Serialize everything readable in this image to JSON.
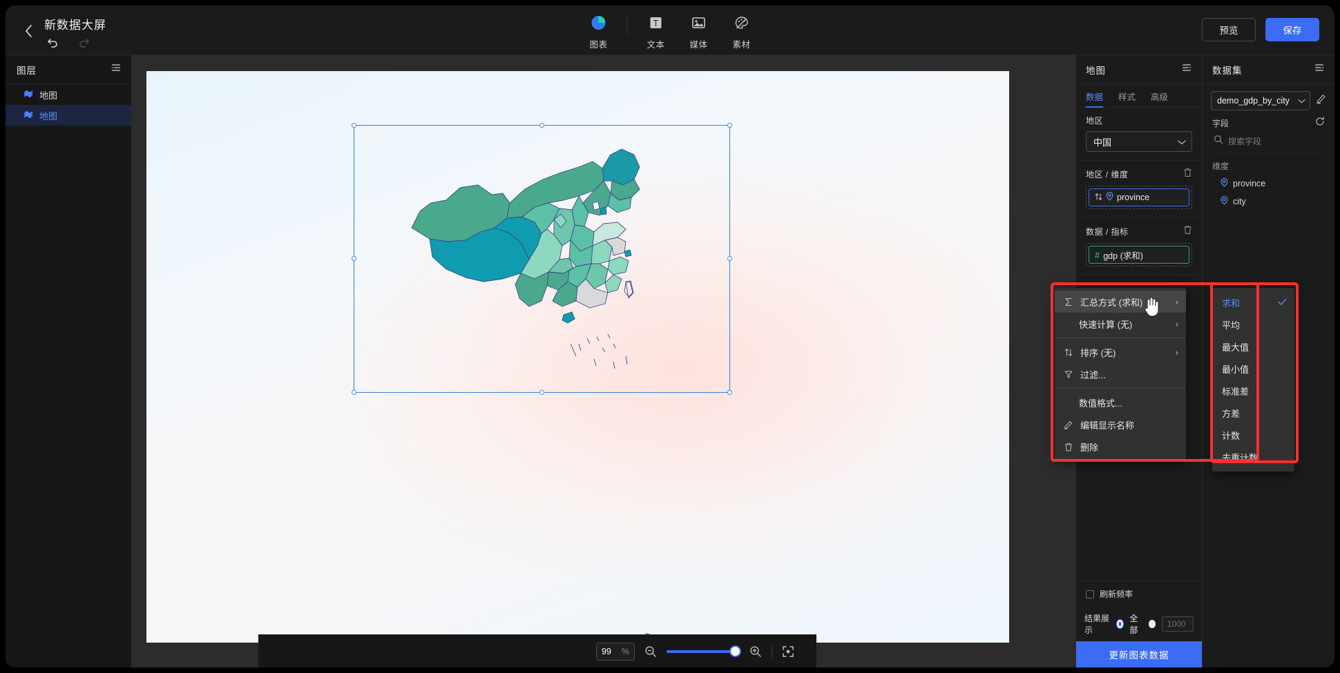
{
  "topbar": {
    "back_icon": "chevron-left-icon",
    "title": "新数据大屏",
    "undo_icon": "undo-icon",
    "redo_icon": "redo-icon",
    "tools": [
      {
        "label": "图表",
        "icon": "pie-chart-icon"
      },
      {
        "label": "文本",
        "icon": "text-t-icon"
      },
      {
        "label": "媒体",
        "icon": "image-icon"
      },
      {
        "label": "素材",
        "icon": "palette-icon"
      }
    ],
    "preview_label": "预览",
    "save_label": "保存"
  },
  "layers": {
    "title": "图层",
    "collapse_icon": "collapse-panel-icon",
    "items": [
      {
        "label": "地图",
        "icon": "map-layer-icon",
        "selected": false
      },
      {
        "label": "地图",
        "icon": "map-layer-icon",
        "selected": true
      }
    ]
  },
  "canvas": {
    "chart_one_title": "地图",
    "chart_two_title": "地图"
  },
  "config": {
    "title": "地图",
    "collapse_icon": "collapse-panel-icon",
    "tabs": [
      {
        "label": "数据",
        "active": true
      },
      {
        "label": "样式",
        "active": false
      },
      {
        "label": "高级",
        "active": false
      }
    ],
    "region_label": "地区",
    "region_value": "中国",
    "dimension_label": "地区 / 维度",
    "dimension_chip": "province",
    "dimension_icons": [
      "sort-icon",
      "location-pin-icon"
    ],
    "metric_label": "数据 / 指标",
    "metric_chip": "gdp (求和)",
    "metric_icon": "hash-icon",
    "delete_icon": "trash-icon",
    "refresh_rate_label": "刷新频率",
    "result_label": "结果展示",
    "result_all_label": "全部",
    "result_limit_placeholder": "1000",
    "update_button": "更新图表数据"
  },
  "context_menu": {
    "items": [
      {
        "label": "汇总方式 (求和)",
        "icon": "sigma-icon",
        "arrow": "›",
        "hover": true
      },
      {
        "label": "快速计算 (无)",
        "icon": "",
        "arrow": "›",
        "hover": false
      },
      {
        "label": "排序 (无)",
        "icon": "sort-icon",
        "arrow": "›",
        "hover": false
      },
      {
        "label": "过滤...",
        "icon": "filter-icon",
        "arrow": "",
        "hover": false
      },
      {
        "label": "数值格式...",
        "icon": "",
        "arrow": "",
        "hover": false
      },
      {
        "label": "编辑显示名称",
        "icon": "pencil-icon",
        "arrow": "",
        "hover": false
      },
      {
        "label": "删除",
        "icon": "trash-icon",
        "arrow": "",
        "hover": false
      }
    ]
  },
  "submenu": {
    "items": [
      {
        "label": "求和",
        "selected": true
      },
      {
        "label": "平均",
        "selected": false
      },
      {
        "label": "最大值",
        "selected": false
      },
      {
        "label": "最小值",
        "selected": false
      },
      {
        "label": "标准差",
        "selected": false
      },
      {
        "label": "方差",
        "selected": false
      },
      {
        "label": "计数",
        "selected": false
      },
      {
        "label": "去重计数",
        "selected": false
      }
    ],
    "check_icon": "check-icon"
  },
  "dataset": {
    "title": "数据集",
    "collapse_icon": "collapse-panel-icon",
    "name": "demo_gdp_by_city",
    "edit_icon": "pencil-icon",
    "fields_label": "字段",
    "refresh_icon": "refresh-icon",
    "search_placeholder": "搜索字段",
    "search_icon": "search-icon",
    "dimension_group": "维度",
    "fields": [
      {
        "label": "province",
        "icon": "location-pin-icon"
      },
      {
        "label": "city",
        "icon": "location-pin-icon"
      }
    ]
  },
  "zoombar": {
    "value": "99",
    "percent": "%",
    "zoom_out_icon": "zoom-out-icon",
    "zoom_in_icon": "zoom-in-icon",
    "fit_icon": "fit-to-screen-icon"
  },
  "colors": {
    "accent": "#3b6cf6",
    "metric_green": "#21a97a",
    "annotation_red": "#ff2f2f",
    "map_palette": [
      "#4aa98c",
      "#1a99a8",
      "#8dd9c0",
      "#5bc0a5",
      "#c9e8dd",
      "#d9d9d9",
      "#0f9bb0"
    ]
  }
}
